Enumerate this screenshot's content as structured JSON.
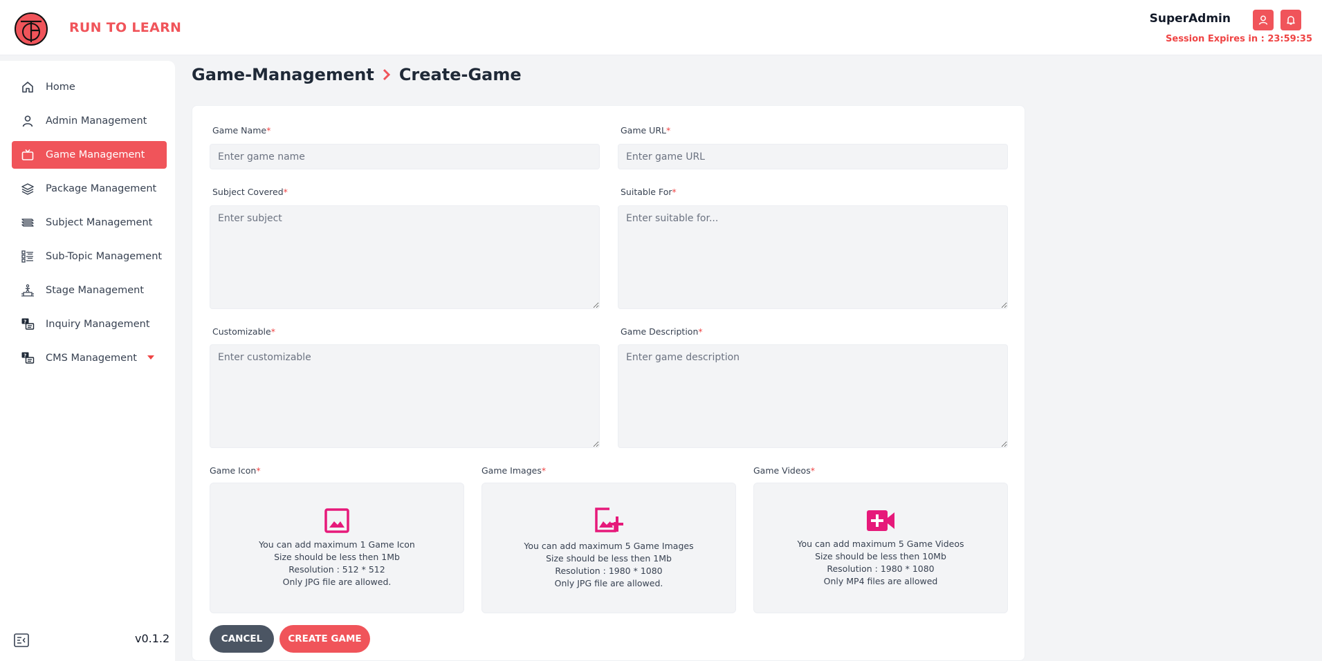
{
  "header": {
    "brand": "RUN TO LEARN",
    "user_name": "SuperAdmin",
    "session_text": "Session Expires in : 23:59:35",
    "accent_color": "#f0545a"
  },
  "sidebar": {
    "items": [
      {
        "label": "Home",
        "icon": "home-icon"
      },
      {
        "label": "Admin Management",
        "icon": "user-icon"
      },
      {
        "label": "Game Management",
        "icon": "tv-icon",
        "active": true
      },
      {
        "label": "Package Management",
        "icon": "layers-icon"
      },
      {
        "label": "Subject Management",
        "icon": "books-icon"
      },
      {
        "label": "Sub-Topic Management",
        "icon": "list-icon"
      },
      {
        "label": "Stage Management",
        "icon": "podium-icon"
      },
      {
        "label": "Inquiry Management",
        "icon": "chat-icon"
      },
      {
        "label": "CMS Management",
        "icon": "chat-icon",
        "has_dropdown": true
      }
    ],
    "version": "v0.1.2"
  },
  "breadcrumb": {
    "parent": "Game-Management",
    "current": "Create-Game"
  },
  "form": {
    "game_name": {
      "label": "Game Name",
      "placeholder": "Enter game name"
    },
    "game_url": {
      "label": "Game URL",
      "placeholder": "Enter game URL"
    },
    "subject_covered": {
      "label": "Subject Covered",
      "placeholder": "Enter subject"
    },
    "suitable_for": {
      "label": "Suitable For",
      "placeholder": "Enter suitable for..."
    },
    "customizable": {
      "label": "Customizable",
      "placeholder": "Enter customizable"
    },
    "game_description": {
      "label": "Game Description",
      "placeholder": "Enter game description"
    },
    "required_mark": "*",
    "uploads": {
      "icon": {
        "label": "Game Icon",
        "lines": [
          "You can add maximum 1 Game Icon",
          "Size should be less then 1Mb",
          "Resolution : 512 * 512",
          "Only JPG file are allowed."
        ]
      },
      "images": {
        "label": "Game Images",
        "lines": [
          "You can add maximum 5 Game Images",
          "Size should be less then 1Mb",
          "Resolution : 1980 * 1080",
          "Only JPG file are allowed."
        ]
      },
      "videos": {
        "label": "Game Videos",
        "lines": [
          "You can add maximum 5 Game Videos",
          "Size should be less then 10Mb",
          "Resolution : 1980 * 1080",
          "Only MP4 files are allowed"
        ]
      }
    },
    "cancel_label": "CANCEL",
    "create_label": "CREATE GAME"
  }
}
